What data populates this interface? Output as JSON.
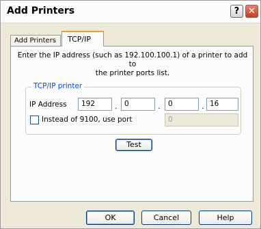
{
  "window": {
    "title": "Add Printers"
  },
  "tabs": [
    {
      "label": "Add Printers"
    },
    {
      "label": "TCP/IP"
    }
  ],
  "intro_line1": "Enter the IP address (such as 192.100.100.1) of a printer to add to",
  "intro_line2": "the printer ports list.",
  "group": {
    "label": "TCP/IP printer",
    "ip_label": "IP Address",
    "ip": [
      "192",
      "0",
      "0",
      "16"
    ],
    "port_checkbox_label": "Instead of 9100, use port",
    "port_checked": false,
    "port_value": "0"
  },
  "buttons": {
    "test": "Test",
    "ok": "OK",
    "cancel": "Cancel",
    "help": "Help"
  },
  "icons": {
    "help": "?",
    "close": "✕"
  }
}
